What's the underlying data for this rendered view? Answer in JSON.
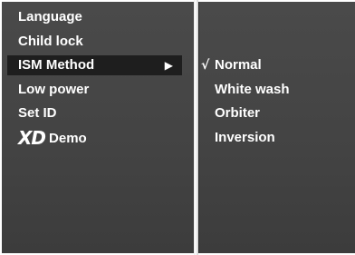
{
  "menu": {
    "items": [
      {
        "label": "Language"
      },
      {
        "label": "Child lock"
      },
      {
        "label": "ISM Method",
        "arrow": "▶"
      },
      {
        "label": "Low power"
      },
      {
        "label": "Set ID"
      },
      {
        "label": "Demo",
        "logo": "XD"
      }
    ]
  },
  "submenu": {
    "check_mark": "√",
    "items": [
      {
        "label": "Normal"
      },
      {
        "label": "White wash"
      },
      {
        "label": "Orbiter"
      },
      {
        "label": "Inversion"
      }
    ]
  },
  "colors": {
    "panel": "#444444",
    "highlight": "#1e1e1e",
    "text": "#ffffff"
  }
}
